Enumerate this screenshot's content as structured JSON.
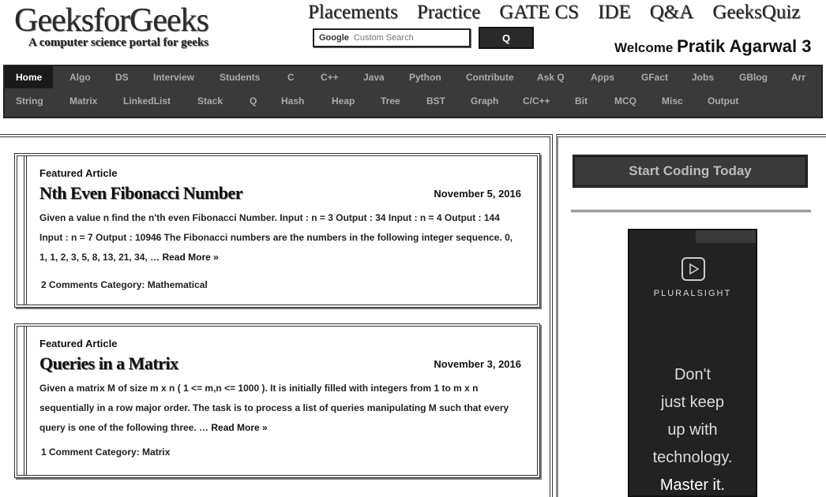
{
  "header": {
    "logo": "GeeksforGeeks",
    "tagline": "A computer science portal for geeks",
    "nav": [
      "Placements",
      "Practice",
      "GATE CS",
      "IDE",
      "Q&A",
      "GeeksQuiz"
    ],
    "search_label": "Google",
    "search_placeholder": "Custom Search",
    "search_button": "Q",
    "welcome_label": "Welcome",
    "user_name": "Pratik Agarwal 3"
  },
  "category_nav": {
    "row1": [
      "Home",
      "Algo",
      "DS",
      "Interview",
      "Students",
      "C",
      "C++",
      "Java",
      "Python",
      "Contribute",
      "Ask Q",
      "Apps",
      "GFact",
      "Jobs",
      "GBlog",
      "Arr"
    ],
    "row2": [
      "String",
      "Matrix",
      "LinkedList",
      "Stack",
      "Q",
      "Hash",
      "Heap",
      "Tree",
      "BST",
      "Graph",
      "C/C++",
      "Bit",
      "MCQ",
      "Misc",
      "Output"
    ]
  },
  "articles": [
    {
      "featured": "Featured Article",
      "title": "Nth Even Fibonacci Number",
      "date": "November 5, 2016",
      "excerpt": "Given a value n find the n'th even Fibonacci Number. Input : n = 3 Output : 34 Input : n = 4 Output : 144 Input : n = 7 Output : 10946 The Fibonacci numbers are the numbers in the following integer sequence. 0, 1, 1, 2, 3, 5, 8, 13, 21, 34, …",
      "read_more": "Read More »",
      "comments": "2 Comments",
      "category_label": "Category:",
      "category": "Mathematical"
    },
    {
      "featured": "Featured Article",
      "title": "Queries in a Matrix",
      "date": "November 3, 2016",
      "excerpt": "Given a matrix M of size m x n ( 1 <= m,n <= 1000 ). It is initially filled with integers from 1 to m x n sequentially in a row major order. The task is to process a list of queries manipulating M such that every query is one of the following three. …",
      "read_more": "Read More »",
      "comments": "1 Comment",
      "category_label": "Category:",
      "category": "Matrix"
    }
  ],
  "sidebar": {
    "start_button": "Start Coding Today",
    "ad": {
      "brand": "PLURALSIGHT",
      "lines": [
        "Don't",
        "just keep",
        "up with",
        "technology.",
        "Master it."
      ]
    }
  }
}
